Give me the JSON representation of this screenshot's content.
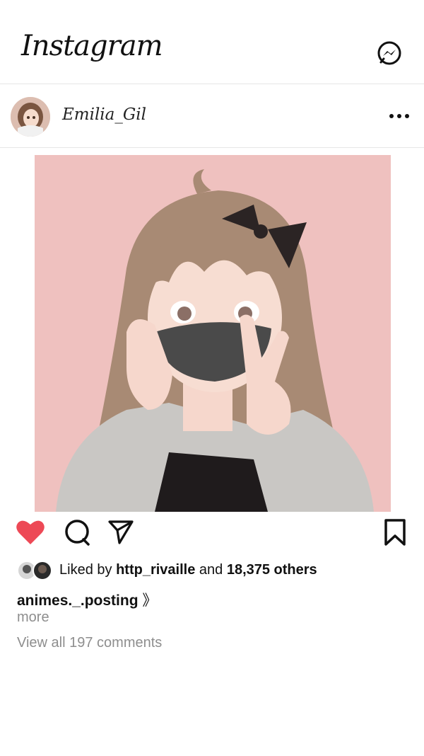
{
  "header": {
    "logo_text": "Instagram",
    "messenger_icon": "messenger-icon"
  },
  "post": {
    "username": "Emilia_Gil",
    "options_icon": "more-options-icon",
    "image_description": "anime-girl-face-mask-peace-sign",
    "actions": {
      "like_icon": "heart-filled-icon",
      "like_color": "#ed4956",
      "comment_icon": "comment-icon",
      "share_icon": "send-icon",
      "save_icon": "bookmark-icon"
    },
    "likes": {
      "prefix": "Liked by",
      "user": "http_rivaille",
      "joiner": "and",
      "count": "18,375 others"
    },
    "caption": {
      "username": "animes._.posting",
      "text": "》"
    },
    "more_label": "more",
    "comments_label": "View all 197 comments"
  },
  "colors": {
    "background": "#ffffff",
    "muted_text": "#8e8e8e",
    "photo_bg": "#efc1bf"
  }
}
